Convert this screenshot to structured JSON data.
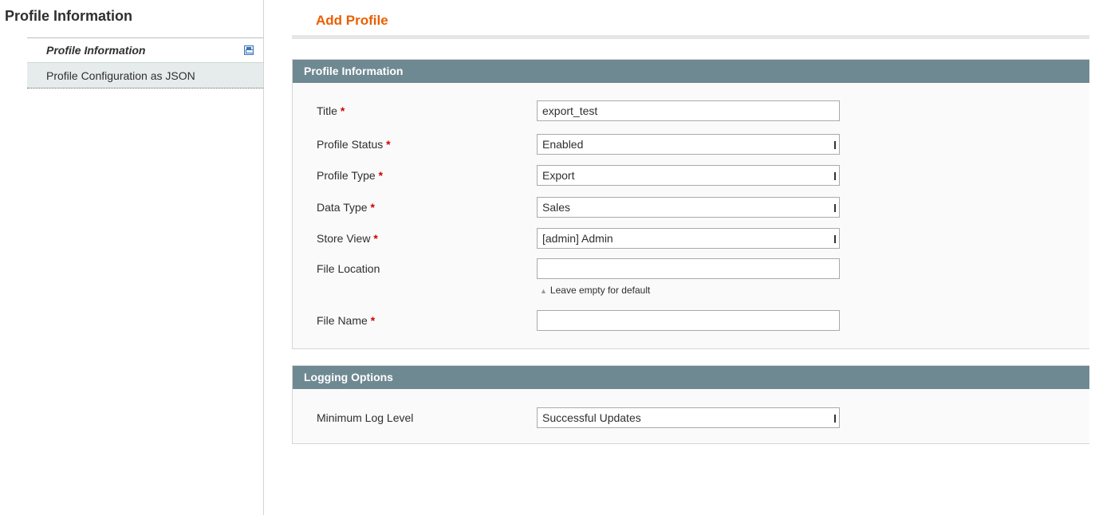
{
  "sidebar": {
    "title": "Profile Information",
    "tabs": [
      {
        "label": "Profile Information",
        "active": true,
        "icon": "save-icon"
      },
      {
        "label": "Profile Configuration as JSON",
        "active": false
      }
    ]
  },
  "page": {
    "title": "Add Profile"
  },
  "profile_fieldset": {
    "header": "Profile Information",
    "fields": {
      "title": {
        "label": "Title",
        "value": "export_test",
        "required": true
      },
      "profile_status": {
        "label": "Profile Status",
        "value": "Enabled",
        "required": true
      },
      "profile_type": {
        "label": "Profile Type",
        "value": "Export",
        "required": true
      },
      "data_type": {
        "label": "Data Type",
        "value": "Sales",
        "required": true
      },
      "store_view": {
        "label": "Store View",
        "value": "[admin] Admin",
        "required": true
      },
      "file_location": {
        "label": "File Location",
        "value": "",
        "hint": "Leave empty for default",
        "required": false
      },
      "file_name": {
        "label": "File Name",
        "value": "",
        "required": true
      }
    },
    "required_marker": "*"
  },
  "logging_fieldset": {
    "header": "Logging Options",
    "fields": {
      "min_log_level": {
        "label": "Minimum Log Level",
        "value": "Successful Updates"
      }
    }
  },
  "colors": {
    "accent": "#eb5e00",
    "fieldset_header": "#6f8992",
    "required": "#d10000"
  }
}
